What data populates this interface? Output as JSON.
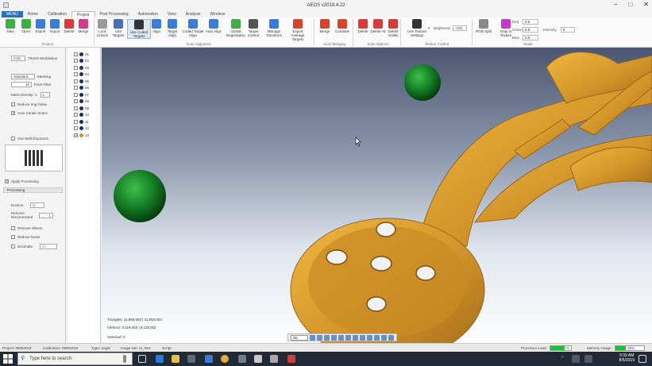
{
  "window": {
    "title": "AEOS v2019.4.22",
    "min": "–",
    "max": "□",
    "close": "✕"
  },
  "tabs": [
    "MENU",
    "Home",
    "Calibration",
    "Project",
    "Post Processing",
    "Automation",
    "View",
    "Analysis",
    "Wireless"
  ],
  "active_tab": "Project",
  "ribbon": {
    "groups": [
      "Project",
      "Scan Alignment",
      "Scan Merging",
      "Scan Options",
      "Texture Control",
      "Mode"
    ],
    "buttons": [
      {
        "label": "New",
        "icon": "new-project-icon",
        "color": "#3fae49"
      },
      {
        "label": "Open",
        "icon": "open-folder-icon",
        "color": "#3fae49"
      },
      {
        "label": "Export",
        "icon": "export-icon",
        "color": "#3b7bd4"
      },
      {
        "label": "Import",
        "icon": "import-icon",
        "color": "#3b7bd4"
      },
      {
        "label": "Delete",
        "icon": "delete-x-icon",
        "color": "#d83b3b"
      },
      {
        "label": "Merge",
        "icon": "merge-icon",
        "color": "#cf3c8a"
      },
      {
        "label": "Lock Unlock",
        "icon": "lock-icon",
        "color": "#9a9a9a"
      },
      {
        "label": "Use Targets",
        "icon": "targets-icon",
        "color": "#4a6fb5"
      },
      {
        "label": "Use Coded Targets",
        "icon": "coded-targets-icon",
        "color": "#333333"
      },
      {
        "label": "Align",
        "icon": "align-icon",
        "color": "#3b7bd4"
      },
      {
        "label": "Target Align",
        "icon": "target-align-icon",
        "color": "#3b7bd4"
      },
      {
        "label": "Coded Target Align",
        "icon": "coded-target-align-icon",
        "color": "#3b7bd4"
      },
      {
        "label": "Auto Align",
        "icon": "auto-align-icon",
        "color": "#3b7bd4"
      },
      {
        "label": "Global Registration",
        "icon": "global-registration-icon",
        "color": "#3fae49"
      },
      {
        "label": "Target Control",
        "icon": "target-control-icon",
        "color": "#555555"
      },
      {
        "label": "Manage Transform",
        "icon": "manage-transform-icon",
        "color": "#3b7bd4"
      },
      {
        "label": "Export Average Targets",
        "icon": "export-average-targets-icon",
        "color": "#d4442f"
      },
      {
        "label": "Merge",
        "icon": "scan-merge-icon",
        "color": "#d4442f"
      },
      {
        "label": "Combine",
        "icon": "combine-icon",
        "color": "#d4442f"
      },
      {
        "label": "Delete",
        "icon": "scan-delete-icon",
        "color": "#d83b3b"
      },
      {
        "label": "Delete All",
        "icon": "delete-all-icon",
        "color": "#d83b3b"
      },
      {
        "label": "Delete Visible",
        "icon": "delete-visible-icon",
        "color": "#d83b3b"
      },
      {
        "label": "Use Texture Settings",
        "icon": "texture-settings-icon",
        "color": "#333333"
      },
      {
        "label": "RGB Split",
        "icon": "rgb-split-icon",
        "color": "#888888"
      },
      {
        "label": "Gray to Texture",
        "icon": "gray-texture-icon",
        "color": "#c43bc4"
      }
    ],
    "brightness_label": "Brightness",
    "brightness_value": "+1/0",
    "red_label": "Red",
    "red_value": "0.0",
    "green_label": "Green",
    "green_value": "0.0",
    "blue_label": "Blue",
    "blue_value": "0.0",
    "intensity_label": "Intensity",
    "intensity_value": "0"
  },
  "left_panel": {
    "thresh_value": "0.00",
    "thresh_label": "Thresh Modulation",
    "meshing_value": "Standard",
    "meshing_label": "Meshing",
    "point_filter_value": "10",
    "point_filter_label": "Point Filter",
    "mesh_density_label": "Mesh Density: 1:",
    "mesh_density_value": "1",
    "reduce_img_noise": "Reduce Img Noise",
    "auto_center": "Auto Center Scans",
    "multi_exposure": "Use Multi Exposure",
    "apply_processing": "Apply Processing",
    "processing_title": "Processing",
    "erosion_label": "Erosion",
    "erosion_value": "0",
    "remove_disconnected_label": "Remove Disconnected",
    "remove_disconnected_value": "1",
    "remove_slivers": "Remove Slivers",
    "reduce_noise": "Reduce Noise",
    "decimate": "Decimate",
    "decimate_value": "50"
  },
  "scans": [
    "01",
    "02",
    "03",
    "04",
    "05",
    "06",
    "07",
    "08",
    "09",
    "10",
    "11",
    "12",
    "13"
  ],
  "viewport": {
    "triangles": "Triangles: 11,956,603 | 11,956,603",
    "vertices": "Vertices: 6,119,052 | 6,119,052",
    "selected": "Selected: 0",
    "view_mode": "3D"
  },
  "status": {
    "project": "Project: 08052019",
    "calibration": "Calibration: 08052019",
    "type": "Type: single",
    "image_set": "Image Set: Hi_Res",
    "script": "Script:",
    "processor_label": "Processor Load:",
    "processor_value": "%",
    "processor_fraction": 0.7,
    "memory_label": "Memory Usage:",
    "memory_value": "35%",
    "memory_fraction": 0.35
  },
  "taskbar": {
    "search_placeholder": "Type here to search",
    "time": "9:39 AM",
    "date": "8/5/2019"
  }
}
